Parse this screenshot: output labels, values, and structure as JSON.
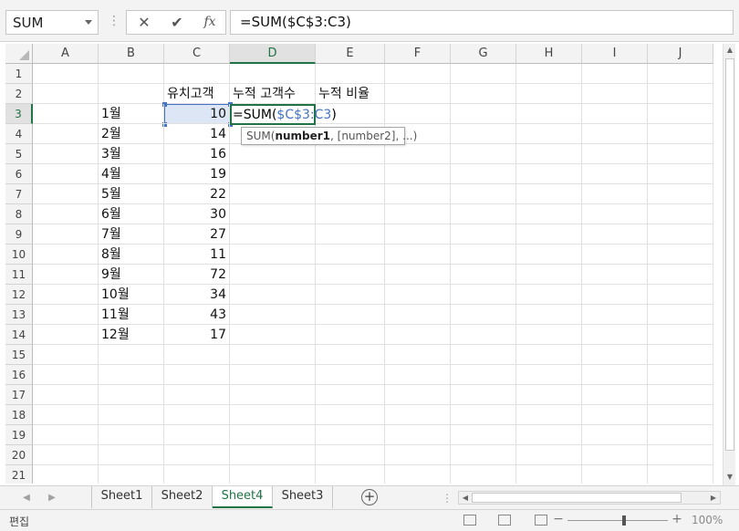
{
  "namebox": {
    "value": "SUM"
  },
  "formula_bar": {
    "cancel_glyph": "✕",
    "enter_glyph": "✔",
    "fx_glyph": "fx",
    "formula": "=SUM($C$3:C3)"
  },
  "columns": [
    "A",
    "B",
    "C",
    "D",
    "E",
    "F",
    "G",
    "H",
    "I",
    "J"
  ],
  "rows": [
    "1",
    "2",
    "3",
    "4",
    "5",
    "6",
    "7",
    "8",
    "9",
    "10",
    "11",
    "12",
    "13",
    "14",
    "15",
    "16",
    "17",
    "18",
    "19",
    "20",
    "21"
  ],
  "headers": {
    "c2": "유치고객",
    "d2": "누적 고객수",
    "e2": "누적 비율"
  },
  "months": [
    "1월",
    "2월",
    "3월",
    "4월",
    "5월",
    "6월",
    "7월",
    "8월",
    "9월",
    "10월",
    "11월",
    "12월"
  ],
  "customers": [
    "10",
    "14",
    "16",
    "19",
    "22",
    "30",
    "27",
    "11",
    "72",
    "34",
    "43",
    "17"
  ],
  "editing": {
    "prefix": "=SUM(",
    "ref": "$C$3:C3",
    "suffix": ")",
    "tooltip_fn": "SUM(",
    "tooltip_arg1": "number1",
    "tooltip_rest": ", [number2], ...)"
  },
  "sheets": [
    "Sheet1",
    "Sheet2",
    "Sheet4",
    "Sheet3"
  ],
  "active_sheet": "Sheet4",
  "status": {
    "mode": "편집",
    "zoom": "100%"
  },
  "colors": {
    "accent": "#217346",
    "reference": "#4472c4",
    "selection_fill": "#dce6f4"
  }
}
